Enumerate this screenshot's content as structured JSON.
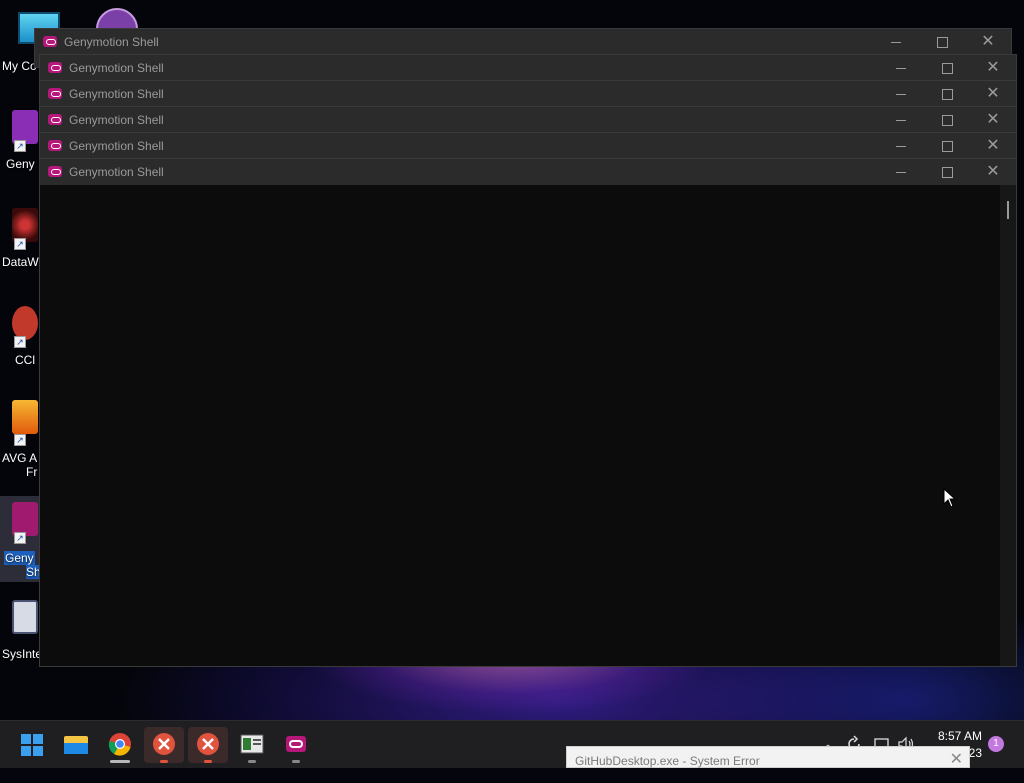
{
  "desktop_icons": [
    {
      "label": "My Co",
      "icon": "computer-icon"
    },
    {
      "label": "Geny",
      "icon": "genymotion-icon"
    },
    {
      "label": "DataW",
      "icon": "datawarrior-icon"
    },
    {
      "label": "CCl",
      "icon": "ccleaner-icon"
    },
    {
      "label": "AVG A",
      "label2": "Fr",
      "icon": "avg-icon"
    },
    {
      "label": "Geny",
      "label2": "Sh",
      "icon": "genymotion-shell-icon"
    },
    {
      "label": "SysInte",
      "icon": "sysinternals-icon"
    }
  ],
  "windows": [
    {
      "title": "Genymotion Shell"
    },
    {
      "title": "Genymotion Shell"
    },
    {
      "title": "Genymotion Shell"
    },
    {
      "title": "Genymotion Shell"
    },
    {
      "title": "Genymotion Shell"
    },
    {
      "title": "Genymotion Shell"
    }
  ],
  "window_controls": {
    "minimize": "—",
    "maximize": "☐",
    "close": "✕"
  },
  "taskbar": {
    "apps": [
      "start-icon",
      "file-explorer-icon",
      "chrome-icon",
      "error-app-icon",
      "error-app-icon",
      "document-app-icon",
      "genymotion-icon"
    ],
    "clock_time": "8:57 AM",
    "clock_date": "23",
    "notification_count": "1"
  },
  "popup": {
    "title": "GitHubDesktop.exe - System Error",
    "close": "✕"
  },
  "colors": {
    "brand": "#b5187a",
    "error": "#e0533d",
    "accent": "#c479e0"
  }
}
